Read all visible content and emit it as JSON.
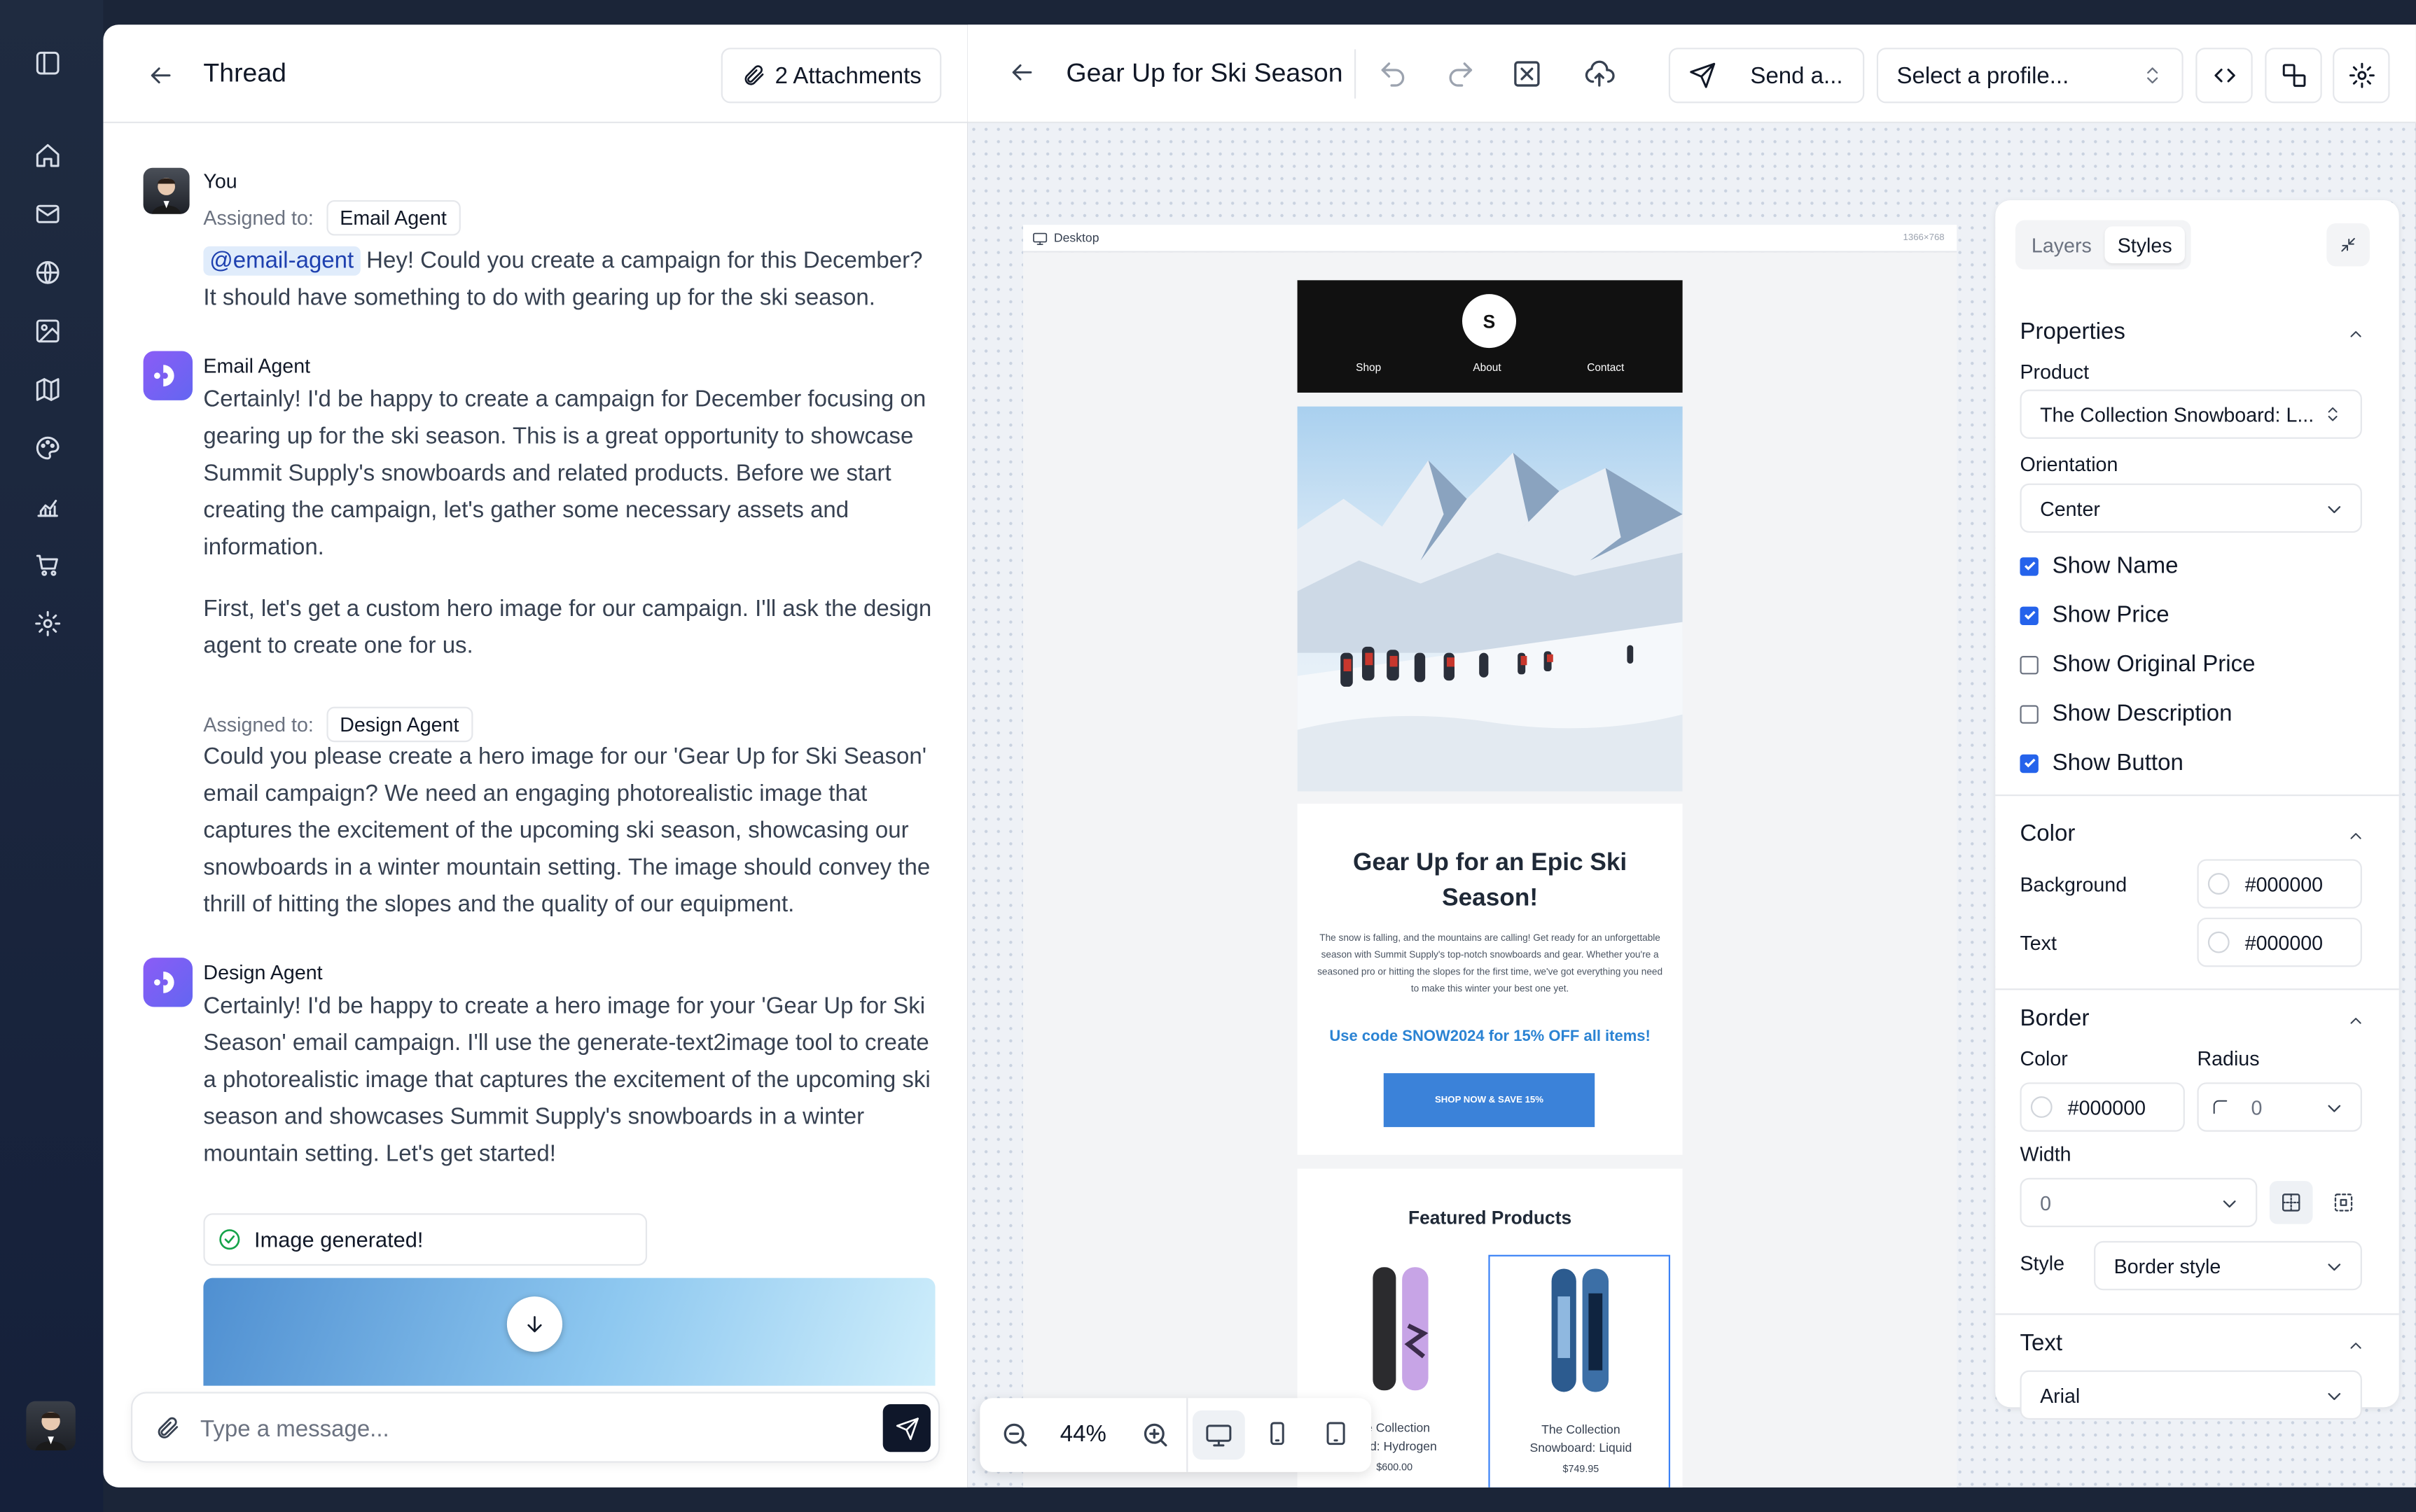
{
  "rail": {
    "items": [
      "panel-toggle",
      "home",
      "mail",
      "globe",
      "image",
      "map",
      "palette",
      "chart",
      "cart",
      "settings"
    ]
  },
  "thread": {
    "title": "Thread",
    "attachments_label": "2 Attachments",
    "messages": [
      {
        "author": "You",
        "assigned_label": "Assigned to:",
        "assigned_to": "Email Agent",
        "mention": "@email-agent",
        "text": " Hey! Could you create a campaign for this December? It should have something to do with gearing up for the ski season."
      },
      {
        "author": "Email Agent",
        "paragraphs": [
          "Certainly! I'd be happy to create a campaign for December focusing on gearing up for the ski season. This is a great opportunity to showcase Summit Supply's snowboards and related products. Before we start creating the campaign, let's gather some necessary assets and information.",
          "First, let's get a custom hero image for our campaign. I'll ask the design agent to create one for us."
        ],
        "assigned_label": "Assigned to:",
        "assigned_to": "Design Agent",
        "delegation": "Could you please create a hero image for our 'Gear Up for Ski Season' email campaign? We need an engaging photorealistic image that captures the excitement of the upcoming ski season, showcasing our snowboards in a winter mountain setting. The image should convey the thrill of hitting the slopes and the quality of our equipment."
      },
      {
        "author": "Design Agent",
        "text": "Certainly! I'd be happy to create a hero image for your 'Gear Up for Ski Season' email campaign. I'll use the generate-text2image tool to create a photorealistic image that captures the excitement of the upcoming ski season and showcases Summit Supply's snowboards in a winter mountain setting. Let's get started!"
      }
    ],
    "image_status": "Image generated!",
    "composer_placeholder": "Type a message..."
  },
  "editor": {
    "title": "Gear Up for Ski Season",
    "send_label": "Send a...",
    "profile_placeholder": "Select a profile...",
    "viewport_label": "Desktop",
    "viewport_size": "1366×768",
    "zoom": "44%"
  },
  "email": {
    "logo": "S",
    "nav": [
      "Shop",
      "About",
      "Contact"
    ],
    "heading": "Gear Up for an Epic Ski Season!",
    "body": "The snow is falling, and the mountains are calling! Get ready for an unforgettable season with Summit Supply's top-notch snowboards and gear. Whether you're a seasoned pro or hitting the slopes for the first time, we've got everything you need to make this winter your best one yet.",
    "promo": "Use code SNOW2024 for 15% OFF all items!",
    "cta": "SHOP NOW & SAVE 15%",
    "products_title": "Featured Products",
    "products": [
      {
        "name": "The Collection Snowboard: Hydrogen",
        "name_visible": "he Collection\noard: Hydrogen",
        "price": "$600.00"
      },
      {
        "name": "The Collection Snowboard: Liquid",
        "name_visible": "The Collection\nSnowboard: Liquid",
        "price": "$749.95"
      }
    ]
  },
  "panel": {
    "tabs": [
      "Layers",
      "Styles"
    ],
    "active_tab": "Styles",
    "properties_title": "Properties",
    "product_label": "Product",
    "product_value": "The Collection Snowboard: L...",
    "orientation_label": "Orientation",
    "orientation_value": "Center",
    "checkboxes": [
      {
        "label": "Show Name",
        "checked": true
      },
      {
        "label": "Show Price",
        "checked": true
      },
      {
        "label": "Show Original Price",
        "checked": false
      },
      {
        "label": "Show Description",
        "checked": false
      },
      {
        "label": "Show Button",
        "checked": true
      }
    ],
    "color_title": "Color",
    "background_label": "Background",
    "background_value": "#000000",
    "text_label": "Text",
    "text_value": "#000000",
    "border_title": "Border",
    "border_color_label": "Color",
    "border_color_value": "#000000",
    "radius_label": "Radius",
    "radius_value": "0",
    "width_label": "Width",
    "width_value": "0",
    "style_label": "Style",
    "style_placeholder": "Border style",
    "text_title": "Text",
    "font_value": "Arial"
  }
}
